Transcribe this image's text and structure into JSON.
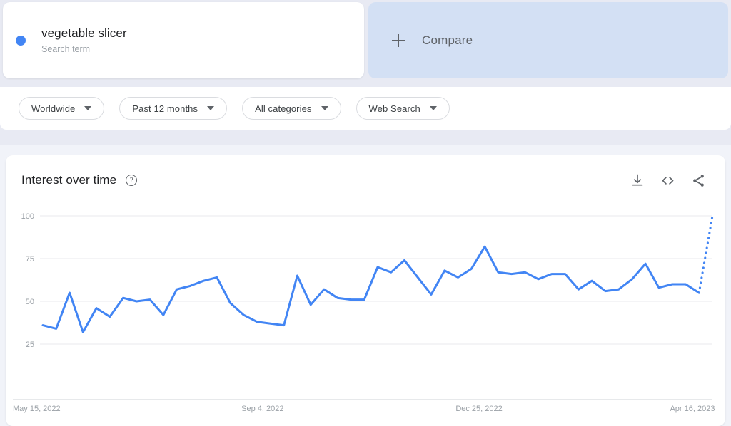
{
  "query": {
    "term": "vegetable slicer",
    "type_label": "Search term",
    "dot_color": "#4285f4"
  },
  "compare": {
    "label": "Compare",
    "icon": "plus-icon",
    "background": "#d3e0f4"
  },
  "filters": [
    {
      "label": "Worldwide",
      "icon": "chevron-down-icon"
    },
    {
      "label": "Past 12 months",
      "icon": "chevron-down-icon"
    },
    {
      "label": "All categories",
      "icon": "chevron-down-icon"
    },
    {
      "label": "Web Search",
      "icon": "chevron-down-icon"
    }
  ],
  "chart_card": {
    "title": "Interest over time",
    "help_icon": "help-circle-icon",
    "help_glyph": "?",
    "actions": [
      {
        "name": "download-icon"
      },
      {
        "name": "embed-code-icon"
      },
      {
        "name": "share-icon"
      }
    ]
  },
  "chart_data": {
    "type": "line",
    "title": "Interest over time",
    "xlabel": "",
    "ylabel": "",
    "ylim": [
      0,
      100
    ],
    "yticks": [
      25,
      50,
      75,
      100
    ],
    "grid": true,
    "legend": false,
    "line_color": "#4285f4",
    "xticks": [
      "May 15, 2022",
      "Sep 4, 2022",
      "Dec 25, 2022",
      "Apr 16, 2023"
    ],
    "xtick_indices": [
      0,
      16,
      32,
      48
    ],
    "series": [
      {
        "name": "vegetable slicer",
        "values": [
          36,
          34,
          55,
          32,
          46,
          41,
          52,
          50,
          51,
          42,
          57,
          59,
          62,
          64,
          49,
          42,
          38,
          37,
          36,
          65,
          48,
          57,
          52,
          51,
          51,
          70,
          67,
          74,
          64,
          54,
          68,
          64,
          69,
          82,
          67,
          66,
          67,
          63,
          66,
          66,
          57,
          62,
          56,
          57,
          63,
          72,
          58,
          60,
          60,
          55,
          100
        ]
      }
    ],
    "partial_from_index": 49,
    "partial_style": "dotted",
    "notes": "Final dotted segment indicates incomplete/partial data period."
  }
}
